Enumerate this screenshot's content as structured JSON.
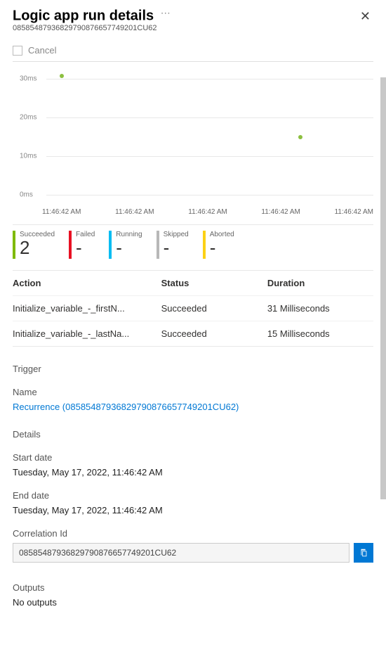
{
  "header": {
    "title": "Logic app run details",
    "run_id": "08585487936829790876657749201CU62"
  },
  "toolbar": {
    "cancel_label": "Cancel"
  },
  "chart_data": {
    "type": "scatter",
    "ylabel": "ms",
    "y_ticks": [
      "30ms",
      "20ms",
      "10ms",
      "0ms"
    ],
    "ylim": [
      0,
      30
    ],
    "x_ticks": [
      "11:46:42 AM",
      "11:46:42 AM",
      "11:46:42 AM",
      "11:46:42 AM",
      "11:46:42 AM"
    ],
    "series": [
      {
        "name": "duration",
        "values": [
          31,
          15
        ]
      }
    ]
  },
  "status_tiles": [
    {
      "label": "Succeeded",
      "value": "2",
      "color": "#7fba00"
    },
    {
      "label": "Failed",
      "value": "-",
      "color": "#e81123"
    },
    {
      "label": "Running",
      "value": "-",
      "color": "#00bcf2"
    },
    {
      "label": "Skipped",
      "value": "-",
      "color": "#b8b8b8"
    },
    {
      "label": "Aborted",
      "value": "-",
      "color": "#fcd116"
    }
  ],
  "table": {
    "headers": [
      "Action",
      "Status",
      "Duration"
    ],
    "rows": [
      {
        "action": "Initialize_variable_-_firstN...",
        "status": "Succeeded",
        "duration": "31 Milliseconds"
      },
      {
        "action": "Initialize_variable_-_lastNa...",
        "status": "Succeeded",
        "duration": "15 Milliseconds"
      }
    ]
  },
  "trigger": {
    "section_label": "Trigger",
    "name_label": "Name",
    "name_value": "Recurrence (08585487936829790876657749201CU62)"
  },
  "details": {
    "section_label": "Details",
    "start_label": "Start date",
    "start_value": "Tuesday, May 17, 2022, 11:46:42 AM",
    "end_label": "End date",
    "end_value": "Tuesday, May 17, 2022, 11:46:42 AM",
    "corr_label": "Correlation Id",
    "corr_value": "08585487936829790876657749201CU62"
  },
  "outputs": {
    "section_label": "Outputs",
    "value": "No outputs"
  }
}
